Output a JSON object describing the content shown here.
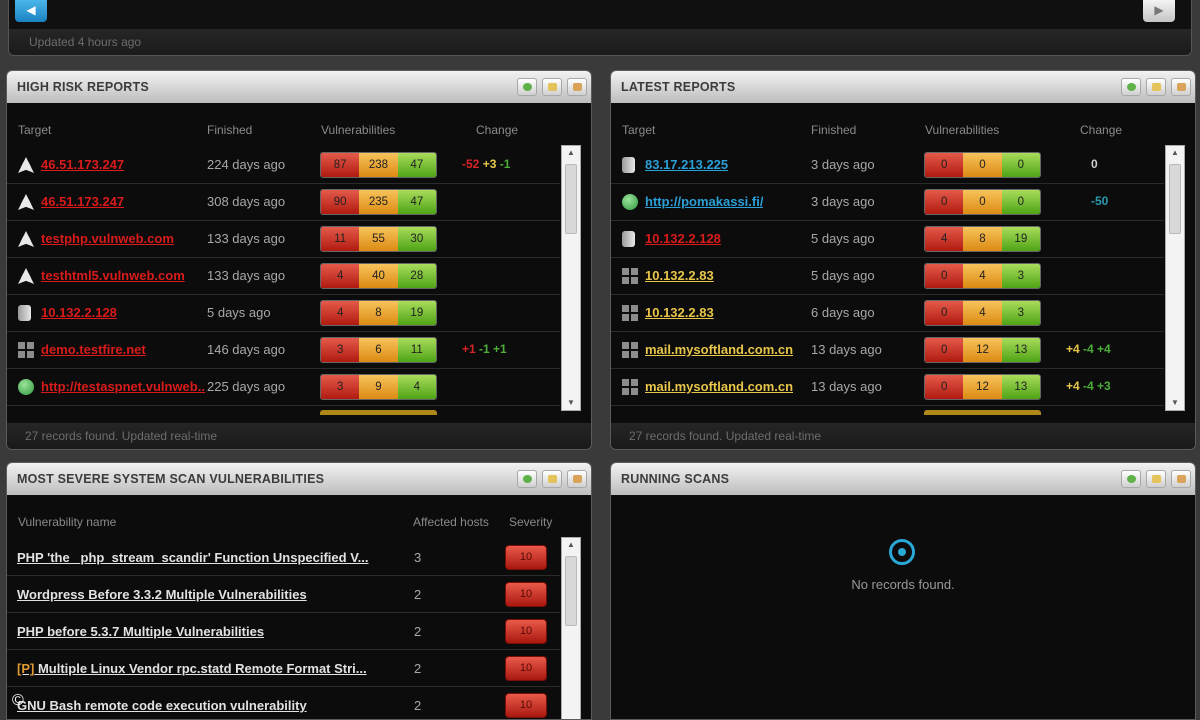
{
  "top": {
    "updated": "Updated 4 hours ago"
  },
  "high_risk": {
    "title": "HIGH RISK REPORTS",
    "columns": {
      "target": "Target",
      "finished": "Finished",
      "vulnerabilities": "Vulnerabilities",
      "change": "Change"
    },
    "rows": [
      {
        "icon": "plane-icon",
        "target": "46.51.173.247",
        "finished": "224 days ago",
        "high": "87",
        "medium": "238",
        "low": "47"
      },
      {
        "icon": "plane-icon",
        "target": "46.51.173.247",
        "finished": "308 days ago",
        "high": "90",
        "medium": "235",
        "low": "47"
      },
      {
        "icon": "plane-icon",
        "target": "testphp.vulnweb.com",
        "finished": "133 days ago",
        "high": "11",
        "medium": "55",
        "low": "30"
      },
      {
        "icon": "plane-icon",
        "target": "testhtml5.vulnweb.com",
        "finished": "133 days ago",
        "high": "4",
        "medium": "40",
        "low": "28"
      },
      {
        "icon": "server-icon",
        "target": "10.132.2.128",
        "finished": "5 days ago",
        "high": "4",
        "medium": "8",
        "low": "19"
      },
      {
        "icon": "windows-icon",
        "target": "demo.testfire.net",
        "finished": "146 days ago",
        "high": "3",
        "medium": "6",
        "low": "11"
      },
      {
        "icon": "globe-icon",
        "target": "http://testaspnet.vulnweb...",
        "finished": "225 days ago",
        "high": "3",
        "medium": "9",
        "low": "4"
      }
    ],
    "change_row1": {
      "a": "-52",
      "b": "+3",
      "c": "-1"
    },
    "change_row6": {
      "a": "+1",
      "b": "-1",
      "c": "+1"
    },
    "footer": "27 records found. Updated real-time"
  },
  "latest": {
    "title": "LATEST REPORTS",
    "columns": {
      "target": "Target",
      "finished": "Finished",
      "vulnerabilities": "Vulnerabilities",
      "change": "Change"
    },
    "rows": [
      {
        "icon": "server-icon",
        "target": "83.17.213.225",
        "color": "blue",
        "finished": "3 days ago",
        "high": "0",
        "medium": "0",
        "low": "0",
        "change": "0"
      },
      {
        "icon": "globe-icon",
        "target": "http://pomakassi.fi/",
        "color": "blue",
        "finished": "3 days ago",
        "high": "0",
        "medium": "0",
        "low": "0",
        "change": "-50"
      },
      {
        "icon": "server-icon",
        "target": "10.132.2.128",
        "color": "red",
        "finished": "5 days ago",
        "high": "4",
        "medium": "8",
        "low": "19",
        "change": ""
      },
      {
        "icon": "windows-icon",
        "target": "10.132.2.83",
        "color": "yellow",
        "finished": "5 days ago",
        "high": "0",
        "medium": "4",
        "low": "3",
        "change": ""
      },
      {
        "icon": "windows-icon",
        "target": "10.132.2.83",
        "color": "yellow",
        "finished": "6 days ago",
        "high": "0",
        "medium": "4",
        "low": "3",
        "change": ""
      },
      {
        "icon": "windows-icon",
        "target": "mail.mysoftland.com.cn",
        "color": "yellow",
        "finished": "13 days ago",
        "high": "0",
        "medium": "12",
        "low": "13",
        "change": ""
      },
      {
        "icon": "windows-icon",
        "target": "mail.mysoftland.com.cn",
        "color": "yellow",
        "finished": "13 days ago",
        "high": "0",
        "medium": "12",
        "low": "13",
        "change": ""
      }
    ],
    "change_row6": {
      "a": "+4",
      "b": "-4",
      "c": "+4"
    },
    "change_row7": {
      "a": "+4",
      "b": "-4",
      "c": "+3"
    },
    "footer": "27 records found. Updated real-time"
  },
  "severe": {
    "title": "MOST SEVERE SYSTEM SCAN VULNERABILITIES",
    "columns": {
      "name": "Vulnerability name",
      "hosts": "Affected hosts",
      "severity": "Severity"
    },
    "rows": [
      {
        "tag": "",
        "name": "PHP 'the _php_stream_scandir' Function Unspecified V...",
        "hosts": "3",
        "severity": "10"
      },
      {
        "tag": "",
        "name": "Wordpress Before 3.3.2 Multiple Vulnerabilities",
        "hosts": "2",
        "severity": "10"
      },
      {
        "tag": "",
        "name": "PHP before 5.3.7 Multiple Vulnerabilities",
        "hosts": "2",
        "severity": "10"
      },
      {
        "tag": "[P]",
        "name": "Multiple Linux Vendor rpc.statd Remote Format Stri...",
        "hosts": "2",
        "severity": "10"
      },
      {
        "tag": "",
        "name": "GNU Bash remote code execution vulnerability",
        "hosts": "2",
        "severity": "10"
      }
    ]
  },
  "running": {
    "title": "RUNNING SCANS",
    "empty": "No records found."
  },
  "copyright": "©"
}
